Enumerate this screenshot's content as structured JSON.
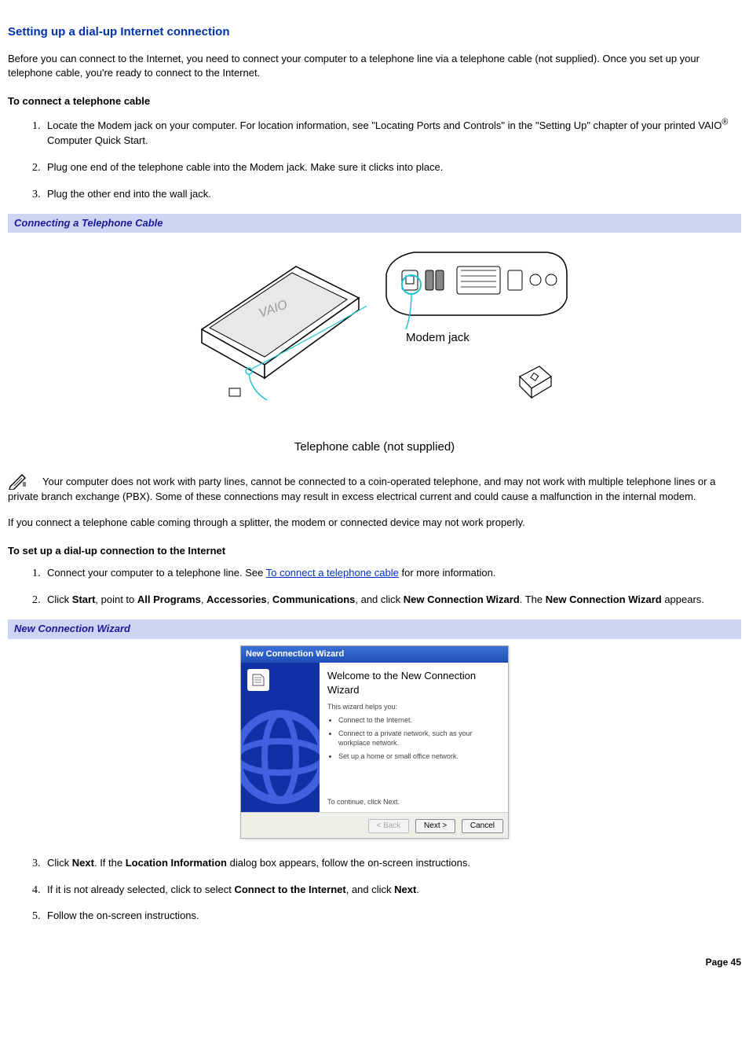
{
  "title": "Setting up a dial-up Internet connection",
  "intro": "Before you can connect to the Internet, you need to connect your computer to a telephone line via a telephone cable (not supplied). Once you set up your telephone cable, you're ready to connect to the Internet.",
  "section1_heading": "To connect a telephone cable",
  "steps1": {
    "s1_a": "Locate the Modem jack on your computer. For location information, see \"Locating Ports and Controls\" in the \"Setting Up\" chapter of your printed VAIO",
    "s1_b": " Computer Quick Start.",
    "s2": "Plug one end of the telephone cable into the Modem jack. Make sure it clicks into place.",
    "s3": "Plug the other end into the wall jack."
  },
  "figure1_bar": "Connecting a Telephone Cable",
  "figure1_label": "Modem jack",
  "figure1_caption": "Telephone cable (not supplied)",
  "note_text": "Your computer does not work with party lines, cannot be connected to a coin-operated telephone, and may not work with multiple telephone lines or a private branch exchange (PBX). Some of these connections may result in excess electrical current and could cause a malfunction in the internal modem.",
  "note_after": "If you connect a telephone cable coming through a splitter, the modem or connected device may not work properly.",
  "section2_heading": "To set up a dial-up connection to the Internet",
  "steps2": {
    "s1_a": "Connect your computer to a telephone line. See ",
    "s1_link": "To connect a telephone cable",
    "s1_b": " for more information.",
    "s2_a": "Click ",
    "s2_b": ", point to ",
    "s2_c": ", ",
    "s2_d": ", ",
    "s2_e": ", and click ",
    "s2_f": ". The ",
    "s2_g": " appears.",
    "b_start": "Start",
    "b_allprog": "All Programs",
    "b_acc": "Accessories",
    "b_comm": "Communications",
    "b_ncw": "New Connection Wizard",
    "b_ncw2": "New Connection Wizard",
    "s3_a": "Click ",
    "s3_b": ". If the ",
    "s3_c": " dialog box appears, follow the on-screen instructions.",
    "b_next": "Next",
    "b_locinfo": "Location Information",
    "s4_a": "If it is not already selected, click to select ",
    "s4_b": ", and click ",
    "s4_c": ".",
    "b_connect": "Connect to the Internet",
    "b_next2": "Next",
    "s5": "Follow the on-screen instructions."
  },
  "figure2_bar": "New Connection Wizard",
  "wizard": {
    "titlebar": "New Connection Wizard",
    "welcome": "Welcome to the New Connection Wizard",
    "helps": "This wizard helps you:",
    "bullets": [
      "Connect to the Internet.",
      "Connect to a private network, such as your workplace network.",
      "Set up a home or small office network."
    ],
    "continue": "To continue, click Next.",
    "btn_back": "< Back",
    "btn_next": "Next >",
    "btn_cancel": "Cancel"
  },
  "page_number": "Page 45",
  "reg_mark": "®"
}
